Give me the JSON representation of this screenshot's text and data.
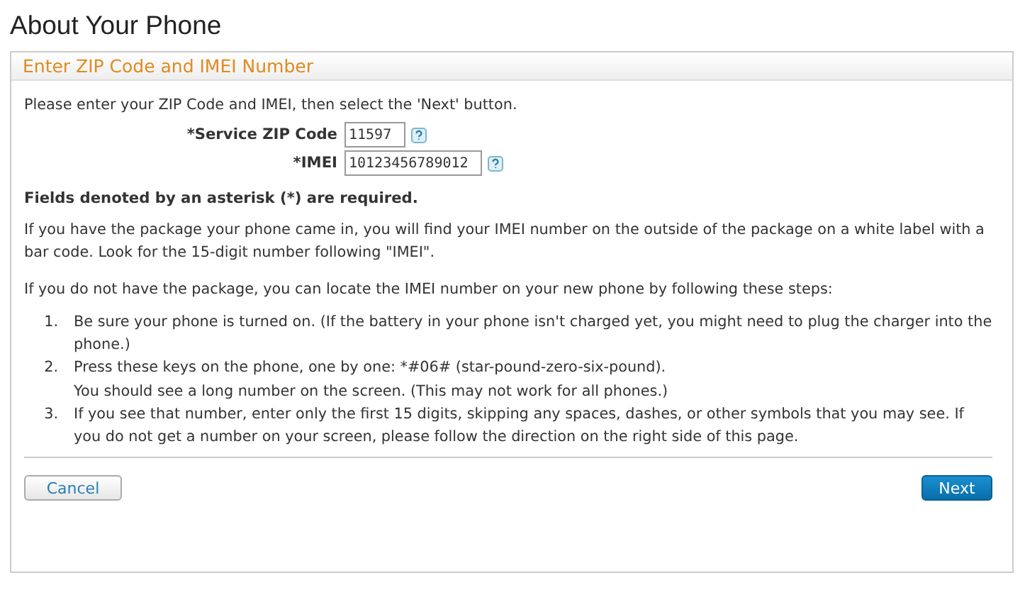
{
  "page_title": "About Your Phone",
  "panel": {
    "title": "Enter ZIP Code and IMEI Number",
    "intro": "Please enter your ZIP Code and IMEI, then select the 'Next' button.",
    "fields": [
      {
        "label": "*Service ZIP Code",
        "value": "11597"
      },
      {
        "label": "*IMEI",
        "value": "10123456789012"
      }
    ],
    "required_note": "Fields denoted by an asterisk (*) are required.",
    "paragraphs": [
      "If you have the package your phone came in, you will find your IMEI number on the outside of the package on a white label with a bar code. Look for the 15-digit number following \"IMEI\".",
      "If you do not have the package, you can locate the IMEI number on your new phone by following these steps:"
    ],
    "steps": [
      {
        "number": "1.",
        "text": "Be sure your phone is turned on. (If the battery in your phone isn't charged yet, you might need to plug the charger into the phone.)"
      },
      {
        "number": "2.",
        "text": "Press these keys on the phone, one by one: *#06# (star-pound-zero-six-pound).",
        "note": "You should see a long number on the screen. (This may not work for all phones.)"
      },
      {
        "number": "3.",
        "text": "If you see that number, enter only the first 15 digits, skipping any spaces, dashes, or other symbols that you may see. If you do not get a number on your screen, please follow the direction on the right side of this page."
      }
    ],
    "buttons": [
      {
        "label": "Cancel",
        "kind": "secondary"
      },
      {
        "label": "Next",
        "kind": "primary"
      }
    ]
  }
}
